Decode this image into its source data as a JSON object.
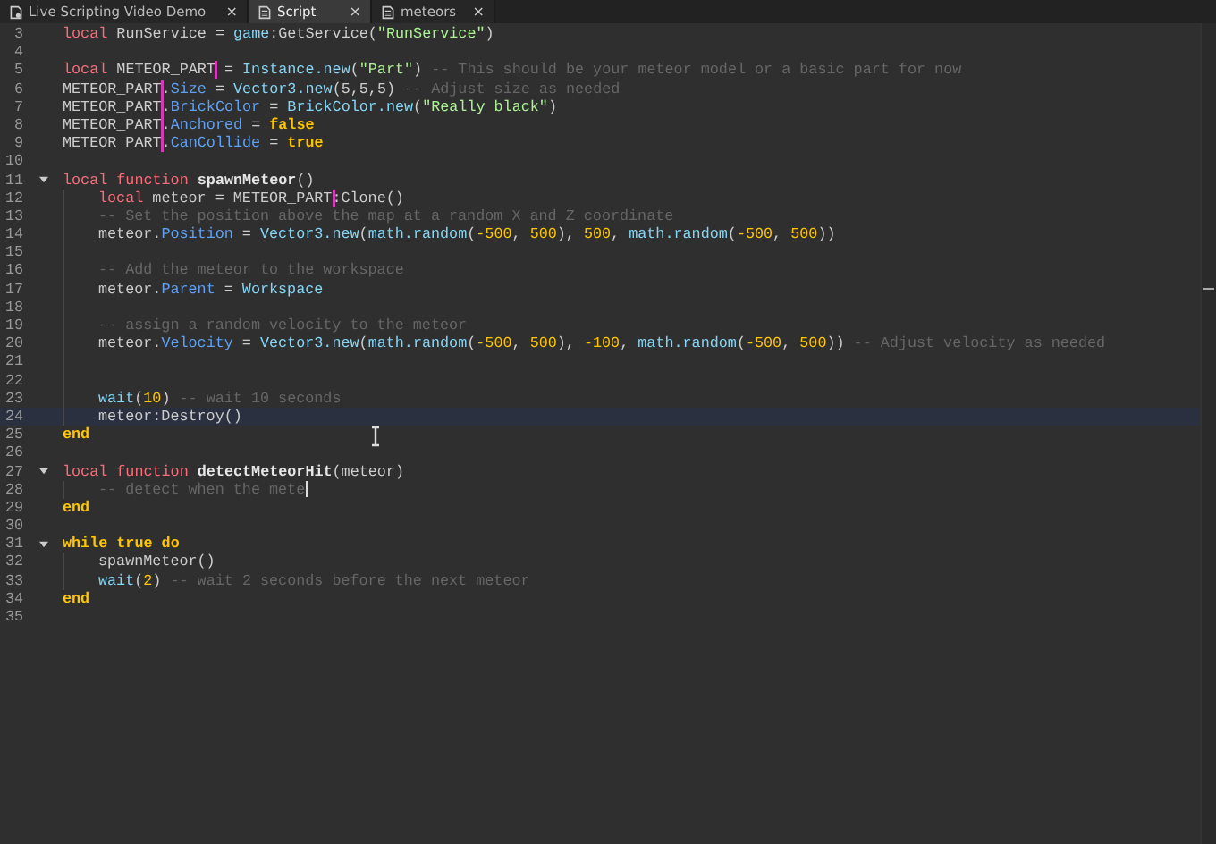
{
  "tabs": [
    {
      "label": "Live Scripting Video Demo",
      "selected": false,
      "close": "×"
    },
    {
      "label": "Script",
      "selected": true,
      "close": "×"
    },
    {
      "label": "meteors",
      "selected": false,
      "close": "×"
    }
  ],
  "editor": {
    "lines": [
      {
        "number": "3",
        "current": false,
        "caret": false,
        "tokens": [
          {
            "kind": "kw",
            "text": "local"
          },
          {
            "kind": "plain",
            "text": " RunService = "
          },
          {
            "kind": "builtin",
            "text": "game"
          },
          {
            "kind": "plain",
            "text": ":GetService("
          },
          {
            "kind": "str",
            "text": "\"RunService\""
          },
          {
            "kind": "plain",
            "text": ")"
          }
        ]
      },
      {
        "number": "4",
        "current": false,
        "caret": false
      },
      {
        "number": "5",
        "current": false,
        "caret": false,
        "tokens": [
          {
            "kind": "kw",
            "text": "local"
          },
          {
            "kind": "plain",
            "text": " METEOR_PART"
          },
          {
            "kind": "plain",
            "text": " = ",
            "marked": true
          },
          {
            "kind": "builtin",
            "text": "Instance.new"
          },
          {
            "kind": "plain",
            "text": "("
          },
          {
            "kind": "str",
            "text": "\"Part\""
          },
          {
            "kind": "plain",
            "text": ") "
          },
          {
            "kind": "cmt",
            "text": "-- This should be your meteor model or a basic part for now"
          }
        ]
      },
      {
        "number": "6",
        "current": false,
        "caret": false,
        "tokens": [
          {
            "kind": "plain",
            "text": "METEOR_PART"
          },
          {
            "kind": "plain",
            "text": ".",
            "marked": true
          },
          {
            "kind": "prop",
            "text": "Size"
          },
          {
            "kind": "plain",
            "text": " = "
          },
          {
            "kind": "builtin",
            "text": "Vector3.new"
          },
          {
            "kind": "plain",
            "text": "(5,5,5) "
          },
          {
            "kind": "cmt",
            "text": "-- Adjust size as needed"
          }
        ]
      },
      {
        "number": "7",
        "current": false,
        "caret": false,
        "tokens": [
          {
            "kind": "plain",
            "text": "METEOR_PART"
          },
          {
            "kind": "plain",
            "text": ".",
            "marked": true
          },
          {
            "kind": "prop",
            "text": "BrickColor"
          },
          {
            "kind": "plain",
            "text": " = "
          },
          {
            "kind": "builtin",
            "text": "BrickColor.new"
          },
          {
            "kind": "plain",
            "text": "("
          },
          {
            "kind": "str",
            "text": "\"Really black\""
          },
          {
            "kind": "plain",
            "text": ")"
          }
        ]
      },
      {
        "number": "8",
        "current": false,
        "caret": false,
        "tokens": [
          {
            "kind": "plain",
            "text": "METEOR_PART"
          },
          {
            "kind": "plain",
            "text": ".",
            "marked": true
          },
          {
            "kind": "prop",
            "text": "Anchored"
          },
          {
            "kind": "plain",
            "text": " = "
          },
          {
            "kind": "ctl",
            "text": "false"
          }
        ]
      },
      {
        "number": "9",
        "current": false,
        "caret": false,
        "tokens": [
          {
            "kind": "plain",
            "text": "METEOR_PART"
          },
          {
            "kind": "plain",
            "text": ".",
            "marked": true
          },
          {
            "kind": "prop",
            "text": "CanCollide"
          },
          {
            "kind": "plain",
            "text": " = "
          },
          {
            "kind": "ctl",
            "text": "true"
          }
        ]
      },
      {
        "number": "10",
        "current": false,
        "caret": false
      },
      {
        "number": "11",
        "current": false,
        "caret": false,
        "expanded": true,
        "tokens": [
          {
            "kind": "kw",
            "text": "local function "
          },
          {
            "kind": "fn",
            "text": "spawnMeteor"
          },
          {
            "kind": "plain",
            "text": "()"
          }
        ],
        "children": [
          {
            "number": "12",
            "current": false,
            "caret": false,
            "tokens": [
              {
                "kind": "kw",
                "text": "local"
              },
              {
                "kind": "plain",
                "text": " meteor = METEOR_PART"
              },
              {
                "kind": "plain",
                "text": ":",
                "marked": true
              },
              {
                "kind": "plain",
                "text": "Clone()"
              }
            ]
          },
          {
            "number": "13",
            "current": false,
            "caret": false,
            "tokens": [
              {
                "kind": "cmt",
                "text": "-- Set the position above the map at a random X and Z coordinate"
              }
            ]
          },
          {
            "number": "14",
            "current": false,
            "caret": false,
            "tokens": [
              {
                "kind": "plain",
                "text": "meteor."
              },
              {
                "kind": "prop",
                "text": "Position"
              },
              {
                "kind": "plain",
                "text": " = "
              },
              {
                "kind": "builtin",
                "text": "Vector3.new"
              },
              {
                "kind": "plain",
                "text": "("
              },
              {
                "kind": "builtin",
                "text": "math.random"
              },
              {
                "kind": "plain",
                "text": "("
              },
              {
                "kind": "num",
                "text": "-500"
              },
              {
                "kind": "plain",
                "text": ", "
              },
              {
                "kind": "num",
                "text": "500"
              },
              {
                "kind": "plain",
                "text": "), "
              },
              {
                "kind": "num",
                "text": "500"
              },
              {
                "kind": "plain",
                "text": ", "
              },
              {
                "kind": "builtin",
                "text": "math.random"
              },
              {
                "kind": "plain",
                "text": "("
              },
              {
                "kind": "num",
                "text": "-500"
              },
              {
                "kind": "plain",
                "text": ", "
              },
              {
                "kind": "num",
                "text": "500"
              },
              {
                "kind": "plain",
                "text": "))"
              }
            ]
          },
          {
            "number": "15",
            "current": false,
            "caret": false
          },
          {
            "number": "16",
            "current": false,
            "caret": false,
            "tokens": [
              {
                "kind": "cmt",
                "text": "-- Add the meteor to the workspace"
              }
            ]
          },
          {
            "number": "17",
            "current": false,
            "caret": false,
            "tokens": [
              {
                "kind": "plain",
                "text": "meteor."
              },
              {
                "kind": "prop",
                "text": "Parent"
              },
              {
                "kind": "plain",
                "text": " = "
              },
              {
                "kind": "builtin",
                "text": "Workspace"
              }
            ]
          },
          {
            "number": "18",
            "current": false,
            "caret": false
          },
          {
            "number": "19",
            "current": false,
            "caret": false,
            "tokens": [
              {
                "kind": "cmt",
                "text": "-- assign a random velocity to the meteor"
              }
            ]
          },
          {
            "number": "20",
            "current": false,
            "caret": false,
            "tokens": [
              {
                "kind": "plain",
                "text": "meteor."
              },
              {
                "kind": "prop",
                "text": "Velocity"
              },
              {
                "kind": "plain",
                "text": " = "
              },
              {
                "kind": "builtin",
                "text": "Vector3.new"
              },
              {
                "kind": "plain",
                "text": "("
              },
              {
                "kind": "builtin",
                "text": "math.random"
              },
              {
                "kind": "plain",
                "text": "("
              },
              {
                "kind": "num",
                "text": "-500"
              },
              {
                "kind": "plain",
                "text": ", "
              },
              {
                "kind": "num",
                "text": "500"
              },
              {
                "kind": "plain",
                "text": "), "
              },
              {
                "kind": "num",
                "text": "-100"
              },
              {
                "kind": "plain",
                "text": ", "
              },
              {
                "kind": "builtin",
                "text": "math.random"
              },
              {
                "kind": "plain",
                "text": "("
              },
              {
                "kind": "num",
                "text": "-500"
              },
              {
                "kind": "plain",
                "text": ", "
              },
              {
                "kind": "num",
                "text": "500"
              },
              {
                "kind": "plain",
                "text": ")) "
              },
              {
                "kind": "cmt",
                "text": "-- Adjust velocity as needed"
              }
            ]
          },
          {
            "number": "21",
            "current": false,
            "caret": false
          },
          {
            "number": "22",
            "current": false,
            "caret": false
          },
          {
            "number": "23",
            "current": false,
            "caret": false,
            "tokens": [
              {
                "kind": "builtin",
                "text": "wait"
              },
              {
                "kind": "plain",
                "text": "("
              },
              {
                "kind": "num",
                "text": "10"
              },
              {
                "kind": "plain",
                "text": ") "
              },
              {
                "kind": "cmt",
                "text": "-- wait 10 seconds"
              }
            ]
          },
          {
            "number": "24",
            "current": true,
            "caret": false,
            "tokens": [
              {
                "kind": "plain",
                "text": "meteor:Destroy()"
              }
            ]
          }
        ]
      },
      {
        "number": "25",
        "current": false,
        "caret": false,
        "tokens": [
          {
            "kind": "ctl",
            "text": "end"
          }
        ]
      },
      {
        "number": "26",
        "current": false,
        "caret": false
      },
      {
        "number": "27",
        "current": false,
        "caret": false,
        "expanded": true,
        "tokens": [
          {
            "kind": "kw",
            "text": "local function "
          },
          {
            "kind": "fn",
            "text": "detectMeteorHit"
          },
          {
            "kind": "plain",
            "text": "(meteor)"
          }
        ],
        "children": [
          {
            "number": "28",
            "current": false,
            "caret": true,
            "tokens": [
              {
                "kind": "cmt",
                "text": "-- detect when the mete"
              }
            ]
          }
        ]
      },
      {
        "number": "29",
        "current": false,
        "caret": false,
        "tokens": [
          {
            "kind": "ctl",
            "text": "end"
          }
        ]
      },
      {
        "number": "30",
        "current": false,
        "caret": false
      },
      {
        "number": "31",
        "current": false,
        "caret": false,
        "expanded": true,
        "tokens": [
          {
            "kind": "ctl",
            "text": "while "
          },
          {
            "kind": "ctl",
            "text": "true "
          },
          {
            "kind": "ctl",
            "text": "do"
          }
        ],
        "children": [
          {
            "number": "32",
            "current": false,
            "caret": false,
            "tokens": [
              {
                "kind": "plain",
                "text": "spawnMeteor()"
              }
            ]
          },
          {
            "number": "33",
            "current": false,
            "caret": false,
            "tokens": [
              {
                "kind": "builtin",
                "text": "wait"
              },
              {
                "kind": "plain",
                "text": "("
              },
              {
                "kind": "num",
                "text": "2"
              },
              {
                "kind": "plain",
                "text": ") "
              },
              {
                "kind": "cmt",
                "text": "-- wait 2 seconds before the next meteor"
              }
            ]
          }
        ]
      },
      {
        "number": "34",
        "current": false,
        "caret": false,
        "tokens": [
          {
            "kind": "ctl",
            "text": "end"
          }
        ]
      },
      {
        "number": "35",
        "current": false,
        "caret": false
      }
    ]
  }
}
